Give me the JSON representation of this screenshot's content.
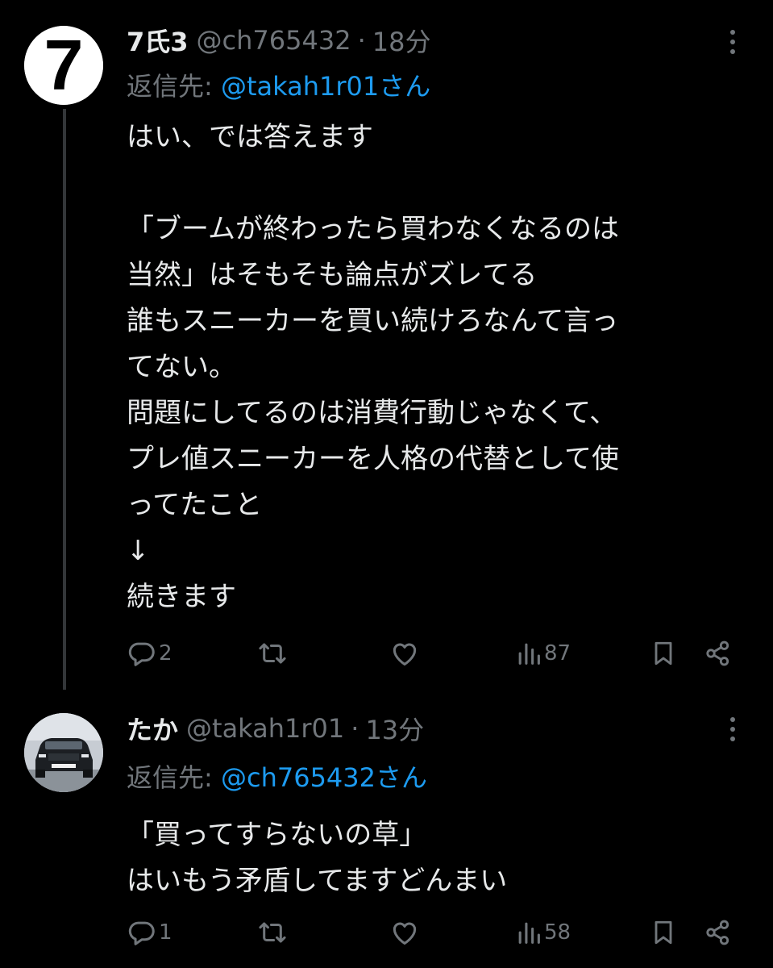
{
  "colors": {
    "background": "#000000",
    "text": "#e7e9ea",
    "secondary": "#71767b",
    "link": "#1d9bf0",
    "thread_line": "#333639"
  },
  "tweets": [
    {
      "avatar_text": "7",
      "display_name": "7氏3",
      "handle": "@ch765432",
      "dot": "·",
      "time": "18分",
      "reply_label": "返信先:",
      "reply_target": "@takah1r01さん",
      "body": "はい、では答えます\n\n「ブームが終わったら買わなくなるのは\n当然」はそもそも論点がズレてる\n誰もスニーカーを買い続けろなんて言っ\nてない。\n問題にしてるのは消費行動じゃなくて、\nプレ値スニーカーを人格の代替として使\nってたこと\n↓\n続きます",
      "replies": "2",
      "retweets": "",
      "likes": "",
      "views": "87"
    },
    {
      "display_name": "たか",
      "handle": "@takah1r01",
      "dot": "·",
      "time": "13分",
      "reply_label": "返信先:",
      "reply_target": "@ch765432さん",
      "body": "「買ってすらないの草」\nはいもう矛盾してますどんまい",
      "replies": "1",
      "retweets": "",
      "likes": "",
      "views": "58"
    }
  ]
}
